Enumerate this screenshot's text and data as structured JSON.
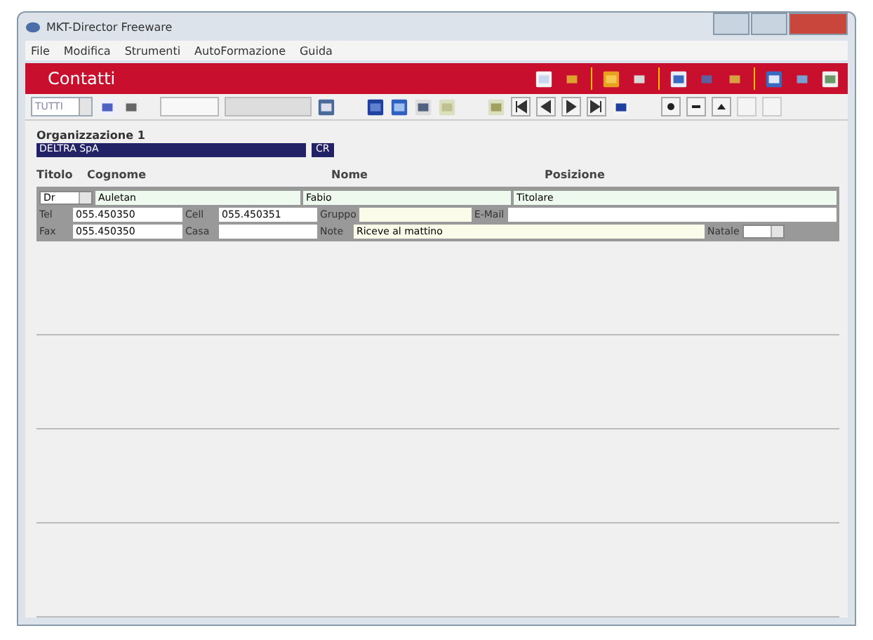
{
  "window": {
    "title": "MKT-Director Freeware"
  },
  "menu": [
    "File",
    "Modifica",
    "Strumenti",
    "AutoFormazione",
    "Guida"
  ],
  "header": {
    "title": "Contatti"
  },
  "toolbar": {
    "filter": "TUTTI"
  },
  "organization": {
    "label": "Organizzazione 1",
    "name": "DELTRA SpA",
    "code": "CR"
  },
  "columns": [
    "Titolo",
    "Cognome",
    "Nome",
    "Posizione"
  ],
  "contact": {
    "title": "Dr",
    "surname": "Auletan",
    "name": "Fabio",
    "position": "Titolare"
  },
  "details": [
    {
      "label": "Tel",
      "value": "055.450350"
    },
    {
      "label": "Cell",
      "value": "055.450351"
    },
    {
      "label": "Gruppo"
    },
    {
      "label": "E-Mail"
    },
    {
      "label": "Fax",
      "value": "055.450350"
    },
    {
      "label": "Casa"
    },
    {
      "label": "Note",
      "value": "Riceve al mattino"
    },
    {
      "label": "Natale"
    }
  ]
}
